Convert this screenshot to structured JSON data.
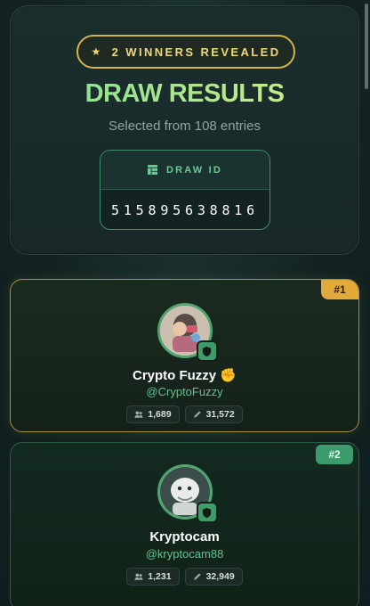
{
  "header": {
    "badge_text": "2 WINNERS REVEALED",
    "badge_icon": "star-icon",
    "title": "DRAW RESULTS",
    "subtitle": "Selected from 108 entries",
    "draw_id_label": "DRAW ID",
    "draw_id_value": "515895638816"
  },
  "colors": {
    "accent_gold": "#e2aa3a",
    "accent_green": "#3f9b6a",
    "handle_green": "#63c391",
    "title_gradient_start": "#7fe08f",
    "title_gradient_end": "#d8ee8a"
  },
  "winners": [
    {
      "rank": "#1",
      "name": "Crypto Fuzzy ✊",
      "handle": "@CryptoFuzzy",
      "followers": "1,689",
      "posts": "31,572",
      "avatar_icon": "avatar-image",
      "verified_icon": "shield-check-icon"
    },
    {
      "rank": "#2",
      "name": "Kryptocam",
      "handle": "@kryptocam88",
      "followers": "1,231",
      "posts": "32,949",
      "avatar_icon": "avatar-image",
      "verified_icon": "shield-check-icon"
    }
  ]
}
